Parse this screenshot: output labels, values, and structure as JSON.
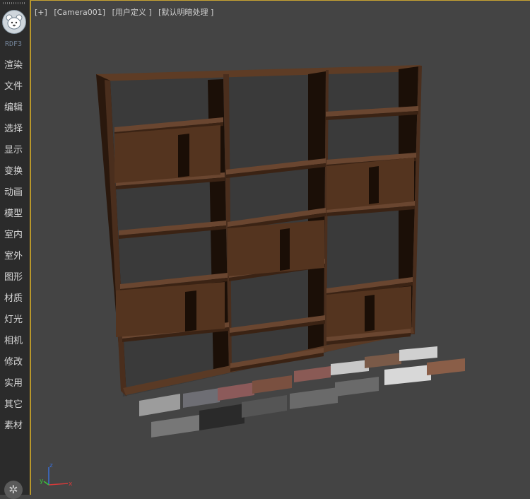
{
  "sidebar": {
    "brand": "RDF3",
    "items": [
      {
        "label": "渲染",
        "name": "sidebar-item-render"
      },
      {
        "label": "文件",
        "name": "sidebar-item-file"
      },
      {
        "label": "编辑",
        "name": "sidebar-item-edit"
      },
      {
        "label": "选择",
        "name": "sidebar-item-select"
      },
      {
        "label": "显示",
        "name": "sidebar-item-display"
      },
      {
        "label": "变换",
        "name": "sidebar-item-transform"
      },
      {
        "label": "动画",
        "name": "sidebar-item-animation"
      },
      {
        "label": "模型",
        "name": "sidebar-item-model"
      },
      {
        "label": "室内",
        "name": "sidebar-item-interior"
      },
      {
        "label": "室外",
        "name": "sidebar-item-exterior"
      },
      {
        "label": "图形",
        "name": "sidebar-item-shapes"
      },
      {
        "label": "材质",
        "name": "sidebar-item-material"
      },
      {
        "label": "灯光",
        "name": "sidebar-item-lights"
      },
      {
        "label": "相机",
        "name": "sidebar-item-camera"
      },
      {
        "label": "修改",
        "name": "sidebar-item-modify"
      },
      {
        "label": "实用",
        "name": "sidebar-item-utilities"
      },
      {
        "label": "其它",
        "name": "sidebar-item-other"
      },
      {
        "label": "素材",
        "name": "sidebar-item-assets"
      }
    ]
  },
  "viewport": {
    "label_plus": "[+]",
    "label_camera": "[Camera001]",
    "label_view": "[用户定义 ]",
    "label_shading": "[默认明暗处理 ]"
  },
  "axis": {
    "x": "x",
    "y": "y",
    "z": "z"
  },
  "colors": {
    "accent": "#c7a232",
    "viewport_bg": "#444444",
    "sidebar_bg": "#2b2b2b",
    "wood": "#4a2e1d",
    "wood_light": "#6b4a30",
    "wood_shadow": "#1e1209"
  },
  "icons": {
    "logo": "bear-logo-icon",
    "settings": "gear-icon"
  }
}
